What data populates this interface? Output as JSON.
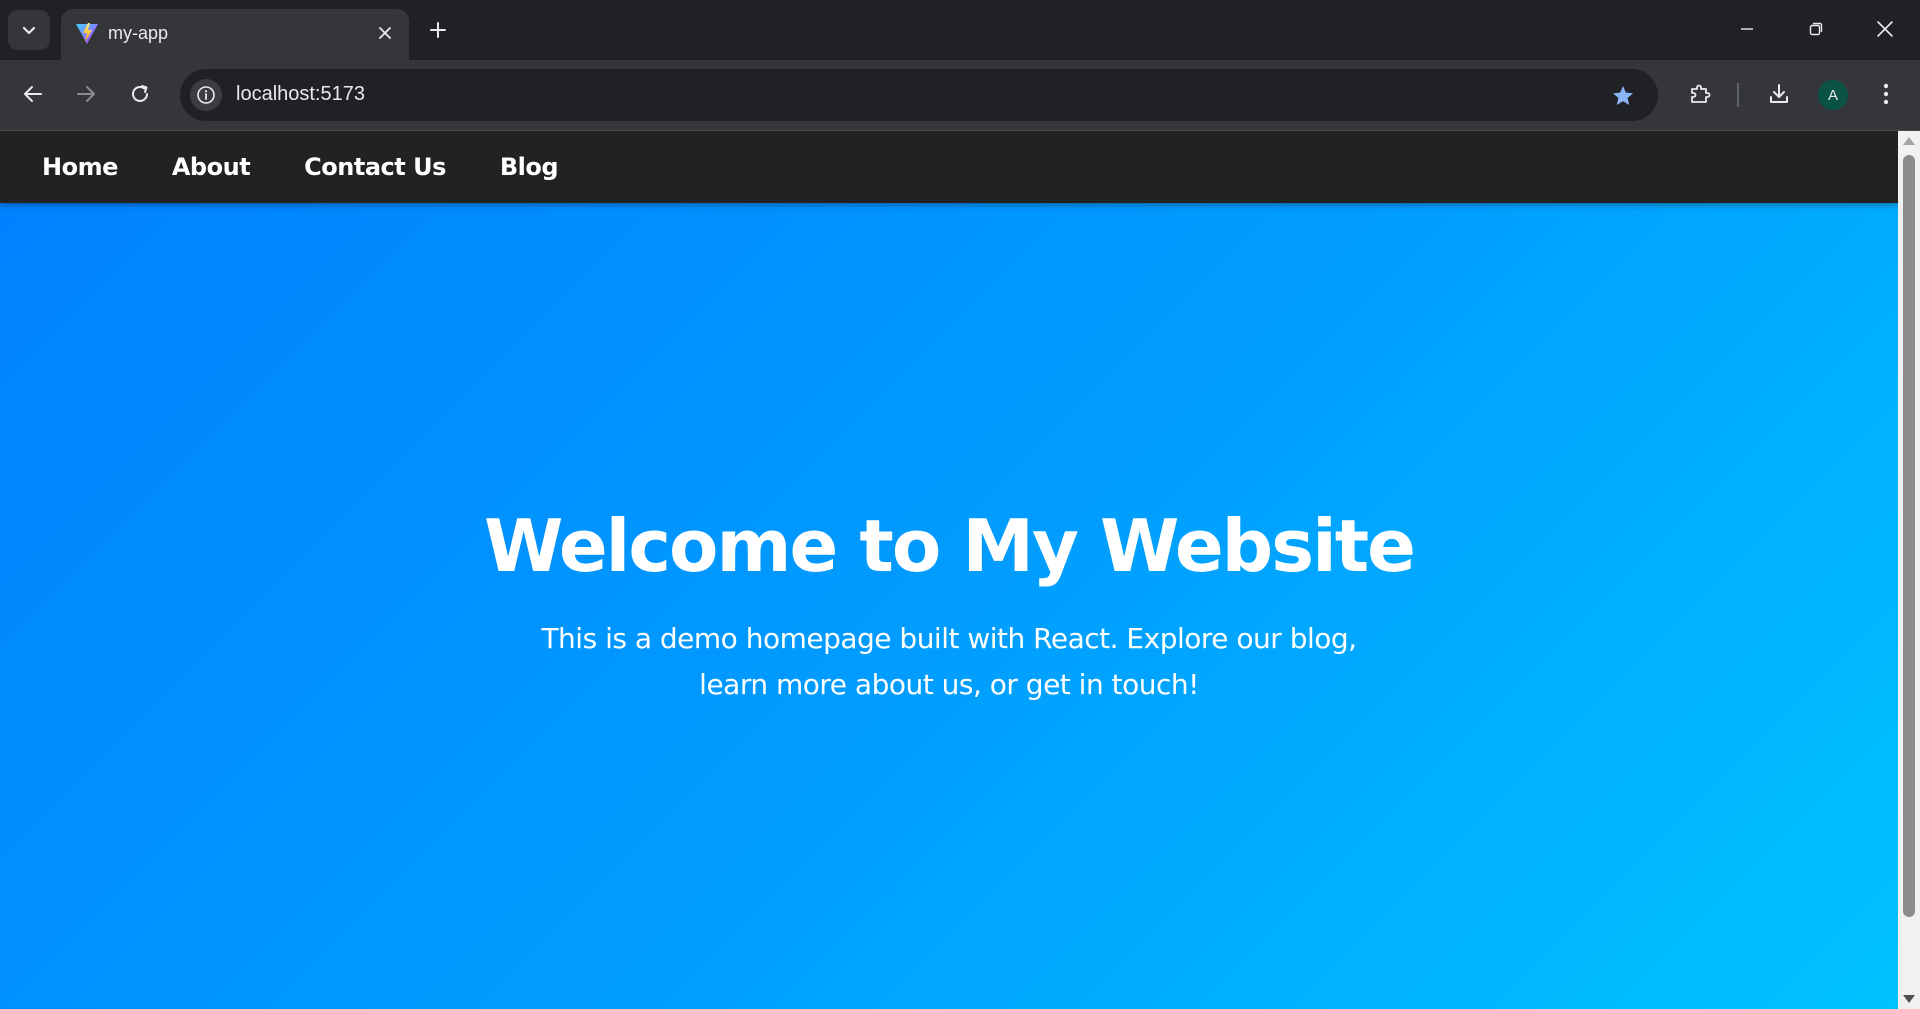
{
  "browser": {
    "tab": {
      "title": "my-app",
      "favicon": "vite-logo-icon"
    },
    "address_bar": {
      "url": "localhost:5173"
    },
    "profile_initial": "A",
    "icons": {
      "tab_search": "chevron-down-icon",
      "tab_close": "close-icon",
      "new_tab": "plus-icon",
      "back": "arrow-left-icon",
      "forward": "arrow-right-icon",
      "reload": "reload-icon",
      "site_info": "info-icon",
      "bookmark": "star-icon",
      "extensions": "puzzle-icon",
      "downloads": "download-icon",
      "menu": "kebab-menu-icon",
      "minimize": "minimize-icon",
      "restore": "restore-icon",
      "close_window": "close-icon"
    },
    "colors": {
      "tabstrip": "#202124",
      "toolbar": "#35363a",
      "bookmark_star": "#8ab4f8",
      "avatar": "#0b5345"
    }
  },
  "site": {
    "nav": {
      "links": [
        "Home",
        "About",
        "Contact Us",
        "Blog"
      ]
    },
    "hero": {
      "title": "Welcome to My Website",
      "text": "This is a demo homepage built with React. Explore our blog, learn more about us, or get in touch!"
    },
    "colors": {
      "nav_bg": "#222222",
      "hero_gradient_start": "#0082fe",
      "hero_gradient_end": "#00c3ff",
      "text": "#ffffff"
    }
  }
}
